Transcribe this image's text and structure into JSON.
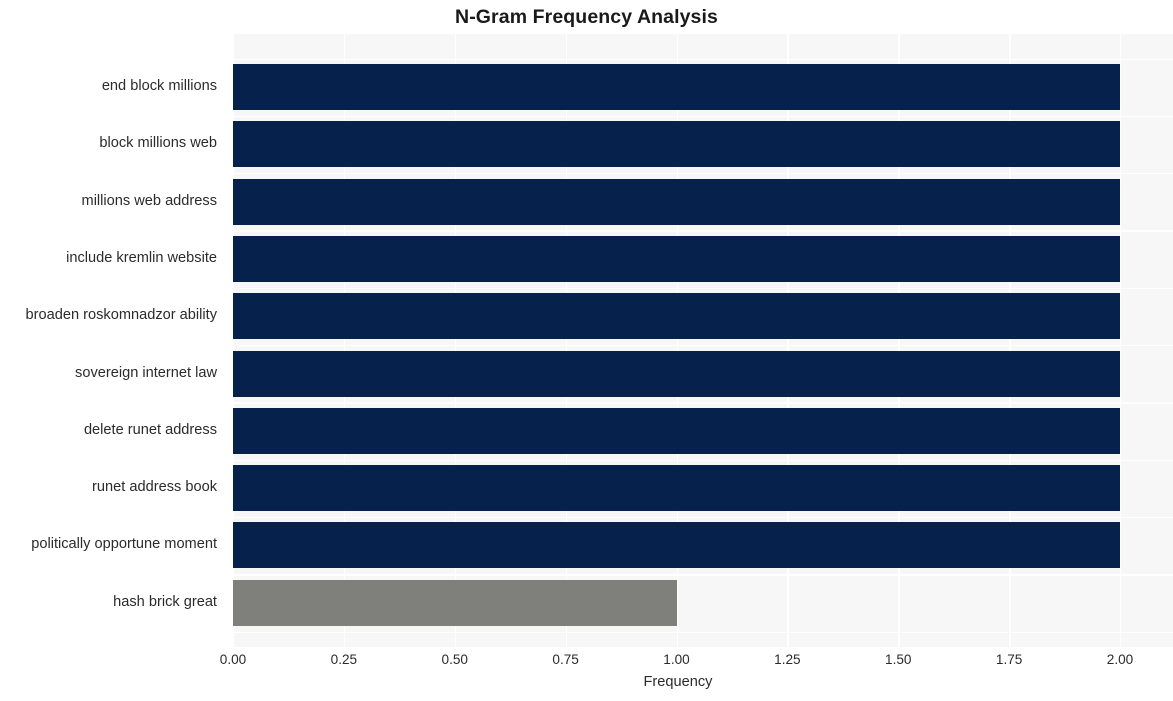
{
  "chart_data": {
    "type": "bar",
    "orientation": "horizontal",
    "title": "N-Gram Frequency Analysis",
    "xlabel": "Frequency",
    "ylabel": "",
    "categories": [
      "end block millions",
      "block millions web",
      "millions web address",
      "include kremlin website",
      "broaden roskomnadzor ability",
      "sovereign internet law",
      "delete runet address",
      "runet address book",
      "politically opportune moment",
      "hash brick great"
    ],
    "values": [
      2,
      2,
      2,
      2,
      2,
      2,
      2,
      2,
      2,
      1
    ],
    "bar_colors": [
      "#06224c",
      "#06224c",
      "#06224c",
      "#06224c",
      "#06224c",
      "#06224c",
      "#06224c",
      "#06224c",
      "#06224c",
      "#7f7f7c"
    ],
    "xlim": [
      0.0,
      2.0
    ],
    "xticks": [
      0.0,
      0.25,
      0.5,
      0.75,
      1.0,
      1.25,
      1.5,
      1.75,
      2.0
    ],
    "xtick_labels": [
      "0.00",
      "0.25",
      "0.50",
      "0.75",
      "1.00",
      "1.25",
      "1.50",
      "1.75",
      "2.00"
    ],
    "grid": true,
    "grid_color": "#ffffff",
    "plot_background": "#f7f7f7",
    "figure_background": "#ffffff",
    "legend": null
  }
}
